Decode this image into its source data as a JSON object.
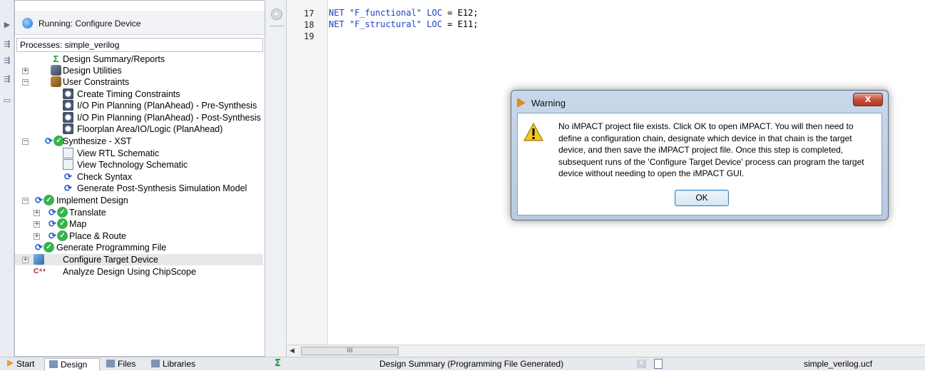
{
  "status": {
    "running_text": "Running: Configure Device"
  },
  "processes": {
    "header": "Processes: simple_verilog",
    "items": [
      {
        "label": "Design Summary/Reports",
        "icon": "sigma-icon"
      },
      {
        "label": "Design Utilities",
        "icon": "tools-icon"
      },
      {
        "label": "User Constraints",
        "icon": "tools-icon"
      },
      {
        "label": "Create Timing Constraints",
        "icon": "clock-icon"
      },
      {
        "label": "I/O Pin Planning (PlanAhead) - Pre-Synthesis",
        "icon": "planahead-icon"
      },
      {
        "label": "I/O Pin Planning (PlanAhead) - Post-Synthesis",
        "icon": "planahead-icon"
      },
      {
        "label": "Floorplan Area/IO/Logic (PlanAhead)",
        "icon": "planahead-icon"
      },
      {
        "label": "Synthesize - XST",
        "icon": "refresh-check-icon"
      },
      {
        "label": "View RTL Schematic",
        "icon": "schematic-icon"
      },
      {
        "label": "View Technology Schematic",
        "icon": "schematic-icon"
      },
      {
        "label": "Check Syntax",
        "icon": "refresh-icon"
      },
      {
        "label": "Generate Post-Synthesis Simulation Model",
        "icon": "refresh-icon"
      },
      {
        "label": "Implement Design",
        "icon": "refresh-check-icon"
      },
      {
        "label": "Translate",
        "icon": "refresh-check-icon"
      },
      {
        "label": "Map",
        "icon": "refresh-check-icon"
      },
      {
        "label": "Place & Route",
        "icon": "refresh-check-icon"
      },
      {
        "label": "Generate Programming File",
        "icon": "refresh-check-icon"
      },
      {
        "label": "Configure Target Device",
        "icon": "chip-icon"
      },
      {
        "label": "Analyze Design Using ChipScope",
        "icon": "chipscope-icon"
      }
    ]
  },
  "editor": {
    "line_numbers": [
      "17",
      "18",
      "19"
    ],
    "lines": [
      {
        "kw": "NET",
        "str": "\"F_functional\"",
        "kw2": "LOC",
        "rest": " = E12;"
      },
      {
        "kw": "NET",
        "str": "\"F_structural\"",
        "kw2": "LOC",
        "rest": " = E11;"
      },
      {
        "kw": "",
        "str": "",
        "kw2": "",
        "rest": ""
      }
    ],
    "scroll_thumb": "III"
  },
  "dialog": {
    "title": "Warning",
    "close_label": "X",
    "message": "No iMPACT project file exists. Click OK to open iMPACT. You will then need to define a configuration chain, designate which device in that chain is the target device, and then save the iMPACT project file. Once this step is completed, subsequent runs of the 'Configure Target Device' process can program the target device without needing to open the iMPACT GUI.",
    "ok_label": "OK",
    "warning_color": "#f0c020"
  },
  "bottom": {
    "tabs": [
      "Start",
      "Design",
      "Files",
      "Libraries"
    ],
    "status": "Design Summary (Programming File Generated)",
    "file": "simple_verilog.ucf"
  }
}
